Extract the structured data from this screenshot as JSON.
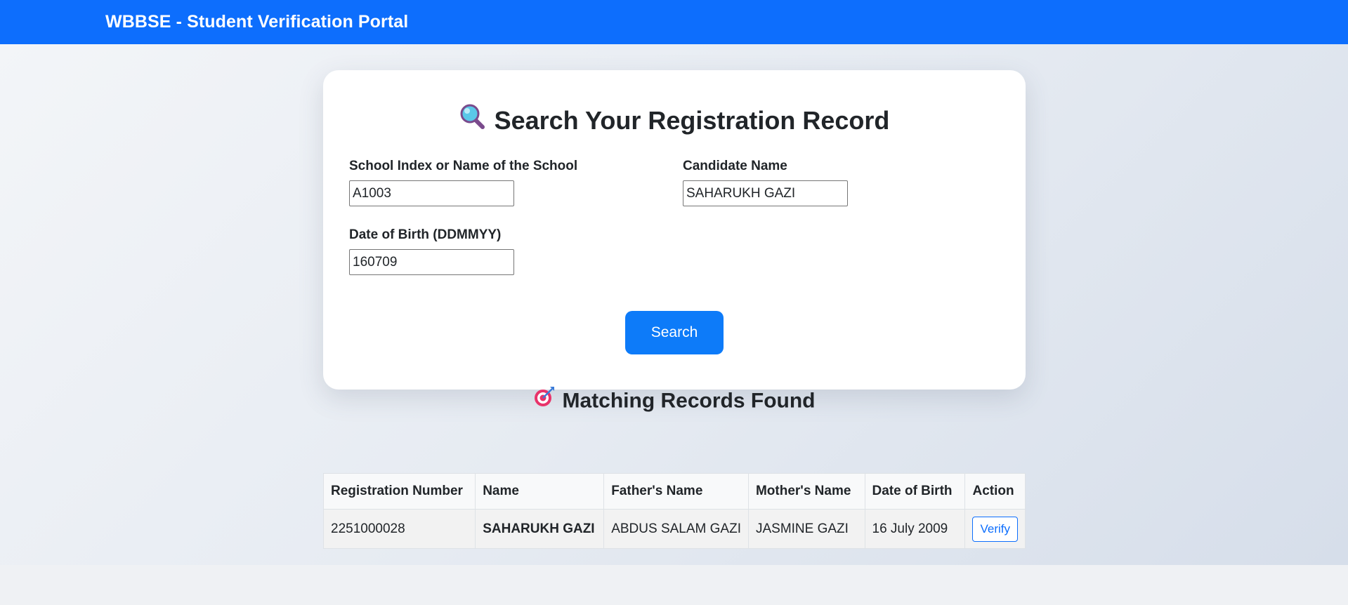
{
  "navbar": {
    "brand": "WBBSE - Student Verification Portal"
  },
  "search_card": {
    "title_icon": "magnifying-glass-icon",
    "title": "Search Your Registration Record",
    "fields": {
      "school": {
        "label": "School Index or Name of the School",
        "value": "A1003"
      },
      "candidate": {
        "label": "Candidate Name",
        "value": "SAHARUKH GAZI"
      },
      "dob": {
        "label": "Date of Birth (DDMMYY)",
        "value": "160709"
      }
    },
    "search_label": "Search"
  },
  "results": {
    "title_icon": "target-dart-icon",
    "title": "Matching Records Found",
    "columns": [
      "Registration Number",
      "Name",
      "Father's Name",
      "Mother's Name",
      "Date of Birth",
      "Action"
    ],
    "rows": [
      {
        "registration_number": "2251000028",
        "name": "SAHARUKH GAZI",
        "father_name": "ABDUS SALAM GAZI",
        "mother_name": "JASMINE GAZI",
        "date_of_birth": "16 July 2009",
        "action_label": "Verify"
      }
    ]
  },
  "colors": {
    "navbar": "#0d6efd",
    "primary_button": "#0d7bf9",
    "verify_outline": "#0d6efd"
  }
}
